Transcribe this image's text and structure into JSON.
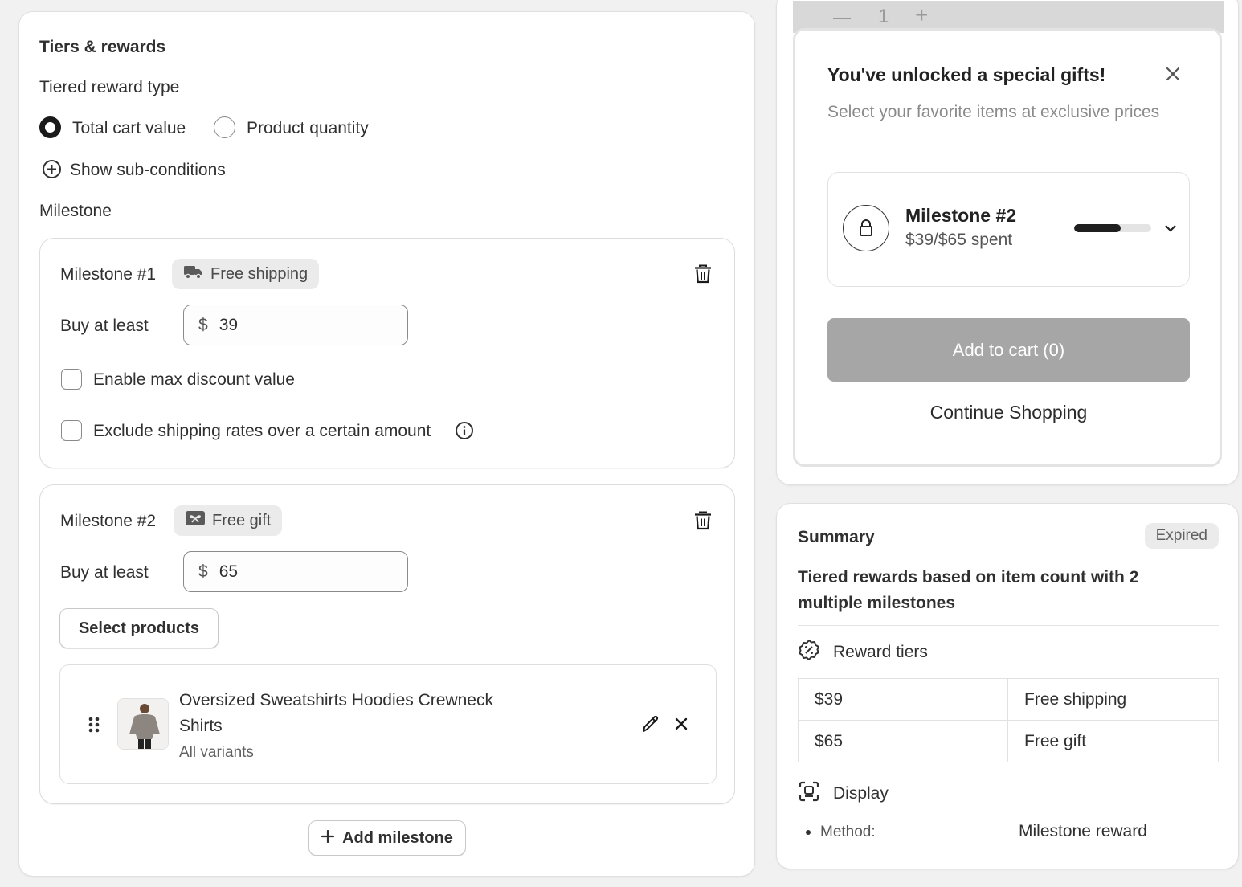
{
  "tiers_card": {
    "title": "Tiers & rewards",
    "reward_type_label": "Tiered reward type",
    "options": [
      "Total cart value",
      "Product quantity"
    ],
    "selected_option": "Total cart value",
    "sub_conditions_label": "Show sub-conditions",
    "milestone_heading": "Milestone",
    "milestones": [
      {
        "title": "Milestone #1",
        "badge": "Free shipping",
        "buy_label": "Buy at least",
        "currency": "$",
        "amount": "39",
        "checkbox1": "Enable max discount value",
        "checkbox2": "Exclude shipping rates over a certain amount"
      },
      {
        "title": "Milestone #2",
        "badge": "Free gift",
        "buy_label": "Buy at least",
        "currency": "$",
        "amount": "65",
        "select_products": "Select products",
        "product_name_line1": "Oversized Sweatshirts Hoodies Crewneck",
        "product_name_line2": "Shirts",
        "product_variants": "All variants"
      }
    ],
    "add_milestone": "Add milestone"
  },
  "popup": {
    "qty": "1",
    "title": "You've unlocked a special gifts!",
    "subtitle": "Select your favorite items at exclusive prices",
    "milestone_name": "Milestone #2",
    "milestone_spent": "$39/$65 spent",
    "progress_fraction": 0.6,
    "add_to_cart": "Add to cart (0)",
    "continue": "Continue Shopping"
  },
  "summary": {
    "title": "Summary",
    "status": "Expired",
    "description": "Tiered rewards based on item count with 2 multiple milestones",
    "reward_tiers_label": "Reward tiers",
    "tiers": [
      {
        "amount": "$39",
        "reward": "Free shipping"
      },
      {
        "amount": "$65",
        "reward": "Free gift"
      }
    ],
    "display_label": "Display",
    "method_label": "Method:",
    "method_value": "Milestone reward"
  }
}
